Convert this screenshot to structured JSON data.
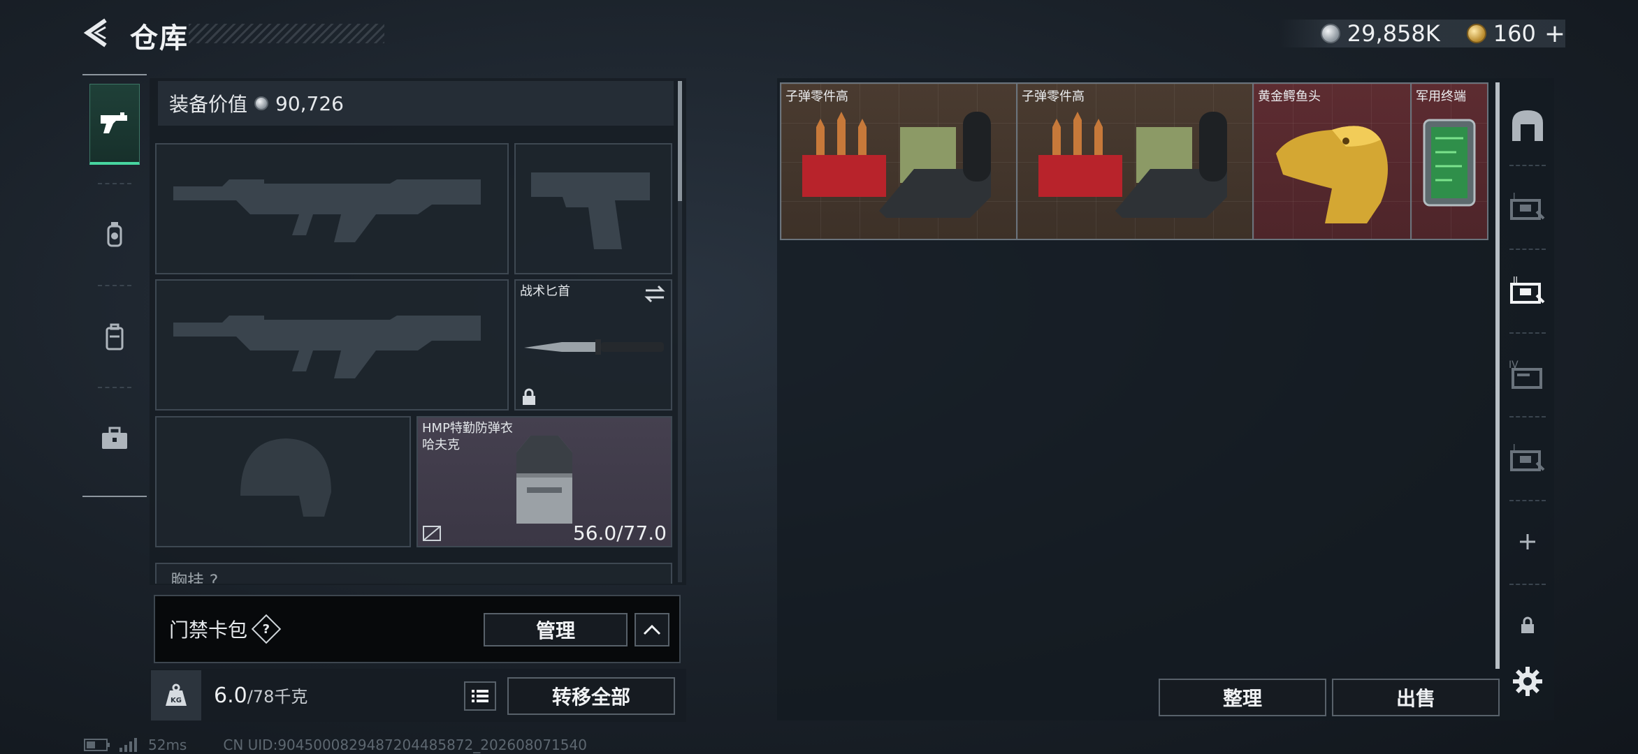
{
  "header": {
    "title": "仓库",
    "currency_silver": "29,858K",
    "currency_gold": "160"
  },
  "equipment": {
    "value_label": "装备价值",
    "value": "90,726",
    "knife_slot_label": "战术匕首",
    "armor_name_line1": "HMP特勤防弹衣",
    "armor_name_line2": "哈夫克",
    "armor_durability": "56.0/77.0",
    "chest_rig_label": "胸挂"
  },
  "keycard": {
    "label": "门禁卡包",
    "help": "?",
    "manage_label": "管理"
  },
  "weight": {
    "current": "6.0",
    "max": "/78千克",
    "transfer_all_label": "转移全部"
  },
  "storage": {
    "items": [
      {
        "name": "子弹零件高",
        "rarity_color": "#4a3b30"
      },
      {
        "name": "子弹零件高",
        "rarity_color": "#4a3b30"
      },
      {
        "name": "黄金鳄鱼头",
        "rarity_color": "#5d2c31"
      },
      {
        "name": "军用终端",
        "rarity_color": "#5d2c31"
      }
    ],
    "sort_label": "整理",
    "sell_label": "出售"
  },
  "left_tabs": [
    "gun-icon",
    "grenade-icon",
    "backpack-icon",
    "briefcase-icon"
  ],
  "right_tabs": [
    "safe-box-icon",
    "storage-tab-1-icon",
    "storage-tab-2-icon",
    "storage-tab-IV-icon",
    "storage-tab-5-icon",
    "add-tab-icon",
    "lock-icon"
  ],
  "status": {
    "ping": "52ms",
    "uid": "CN UID:9045000829487204485872_202608071540"
  }
}
